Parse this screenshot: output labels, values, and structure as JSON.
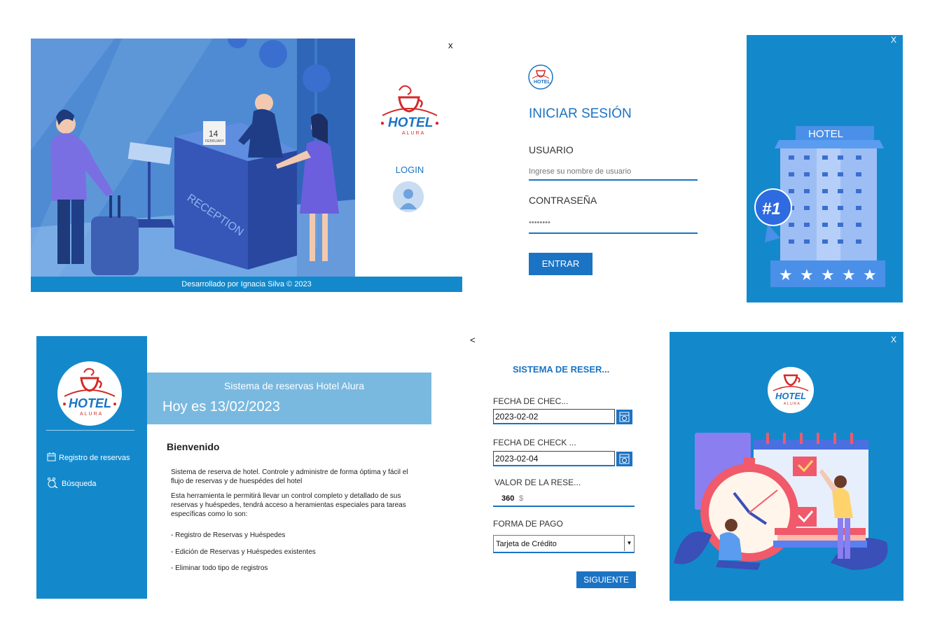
{
  "splash": {
    "close_label": "x",
    "login_label": "LOGIN",
    "footer_text": "Desarrollado por Ignacia Silva © 2023",
    "reception_sign": "RECEPTION",
    "calendar_day": "14",
    "calendar_month": "FEBRUARY"
  },
  "login": {
    "title": "INICIAR SESIÓN",
    "user_label": "USUARIO",
    "user_placeholder": "Ingrese su nombre de usuario",
    "password_label": "CONTRASEÑA",
    "password_value": "••••••••",
    "enter_button": "ENTRAR",
    "close_label": "X",
    "building_sign": "HOTEL",
    "rank_badge": "#1"
  },
  "logo": {
    "word": "HOTEL",
    "subword": "ALURA"
  },
  "dashboard": {
    "nav": [
      {
        "label": "Registro de reservas",
        "icon": "calendar-icon"
      },
      {
        "label": "Búsqueda",
        "icon": "people-search-icon"
      }
    ],
    "header_title": "Sistema de reservas Hotel Alura",
    "header_date": "Hoy es 13/02/2023",
    "welcome": "Bienvenido",
    "paragraph1": "Sistema de reserva de hotel. Controle y administre de forma óptima y fácil el flujo de reservas y de huespédes del hotel",
    "paragraph2": "Esta herramienta le permitirá llevar un control completo y detallado de sus reservas y huéspedes, tendrá acceso a heramientas especiales para tareas específicas como lo son:",
    "items": [
      "- Registro de Reservas y Huéspedes",
      "- Edición de Reservas y Huéspedes existentes",
      "- Eliminar todo tipo de registros"
    ]
  },
  "booking": {
    "back_label": "<",
    "title": "SISTEMA DE RESER...",
    "checkin_label": "FECHA DE CHEC...",
    "checkin_value": "2023-02-02",
    "checkout_label": "FECHA DE CHECK ...",
    "checkout_value": "2023-02-04",
    "amount_label": "VALOR DE LA RESE...",
    "amount_value": "360",
    "currency": "$",
    "payment_label": "FORMA DE PAGO",
    "payment_selected": "Tarjeta de Crédito",
    "next_button": "SIGUIENTE",
    "close_label": "X"
  },
  "colors": {
    "primary": "#1389cc",
    "accent": "#1b73c4",
    "header_light": "#79b9e0",
    "logo_red": "#d62828"
  }
}
